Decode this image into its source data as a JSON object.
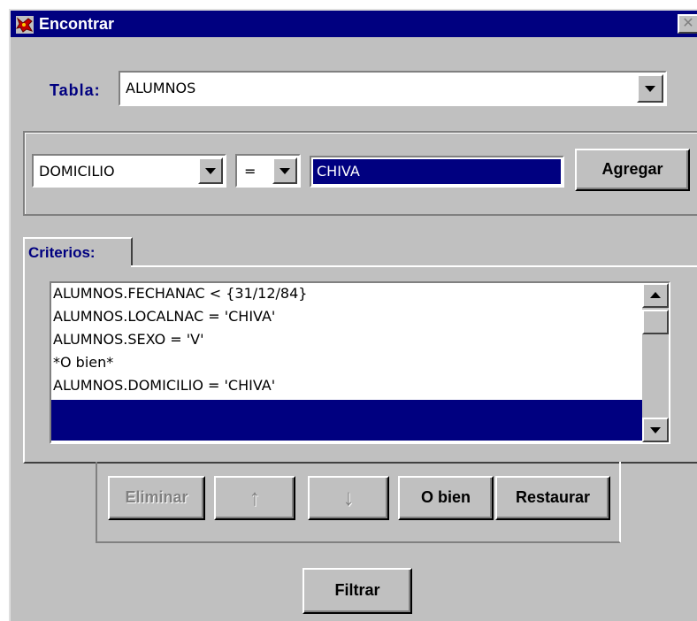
{
  "window": {
    "title": "Encontrar",
    "close_glyph": "✕"
  },
  "tabla": {
    "label": "Tabla:",
    "value": "ALUMNOS"
  },
  "filter_row": {
    "field": "DOMICILIO",
    "operator": "=",
    "value": "CHIVA",
    "add_label": "Agregar"
  },
  "criterios": {
    "tab_label": "Criterios:",
    "items": [
      "ALUMNOS.FECHANAC < {31/12/84}",
      "ALUMNOS.LOCALNAC = 'CHIVA'",
      "ALUMNOS.SEXO = 'V'",
      "*O bien*",
      "ALUMNOS.DOMICILIO = 'CHIVA'",
      ""
    ],
    "selected_index": 5
  },
  "actions": {
    "eliminar": "Eliminar",
    "up_glyph": "↑",
    "down_glyph": "↓",
    "obien": "O bien",
    "restaurar": "Restaurar"
  },
  "filtrar_label": "Filtrar",
  "colors": {
    "titlebar": "#000080",
    "selection": "#000080",
    "face": "#c0c0c0"
  }
}
